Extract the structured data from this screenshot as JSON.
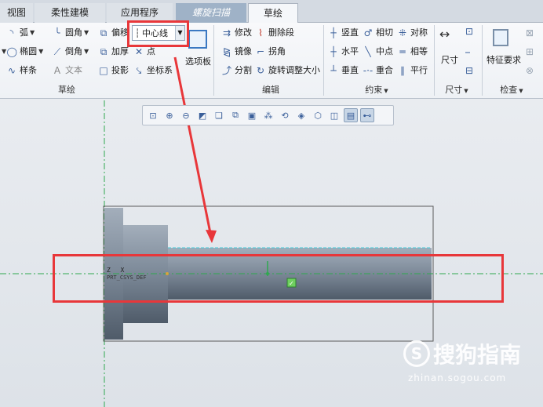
{
  "tabs": [
    {
      "label": "视图"
    },
    {
      "label": "柔性建模"
    },
    {
      "label": "应用程序"
    },
    {
      "label": "螺旋扫描"
    },
    {
      "label": "草绘"
    }
  ],
  "ribbon": {
    "sketch_group": {
      "label": "草绘",
      "items": [
        "弧",
        "圆角",
        "偏移",
        "椭圆",
        "倒角",
        "加厚",
        "点",
        "样条",
        "文本",
        "投影",
        "坐标系"
      ],
      "centerline": "中心线",
      "palette": "选项板"
    },
    "edit_group": {
      "label": "编辑",
      "items": [
        "修改",
        "删除段",
        "镜像",
        "拐角",
        "分割",
        "旋转调整大小"
      ]
    },
    "constraint_group": {
      "label": "约束",
      "items": [
        "竖直",
        "相切",
        "对称",
        "水平",
        "中点",
        "相等",
        "垂直",
        "重合",
        "平行"
      ]
    },
    "dimension_group": {
      "label": "尺寸",
      "items": [
        "尺寸"
      ]
    },
    "inspect_group": {
      "label": "检查",
      "items": [
        "特征要求"
      ]
    }
  },
  "canvas": {
    "csys_label": "PRT_CSYS_DEF",
    "axis_labels": [
      "Z",
      "X"
    ]
  },
  "watermark": {
    "brand": "搜狗指南",
    "url": "zhinan.sogou.com"
  },
  "colors": {
    "annotation_red": "#e8373a",
    "centerline_green": "#2fa84f",
    "shaft_gray": "#6d7a89",
    "ribbon_accent": "#3a78c2"
  }
}
